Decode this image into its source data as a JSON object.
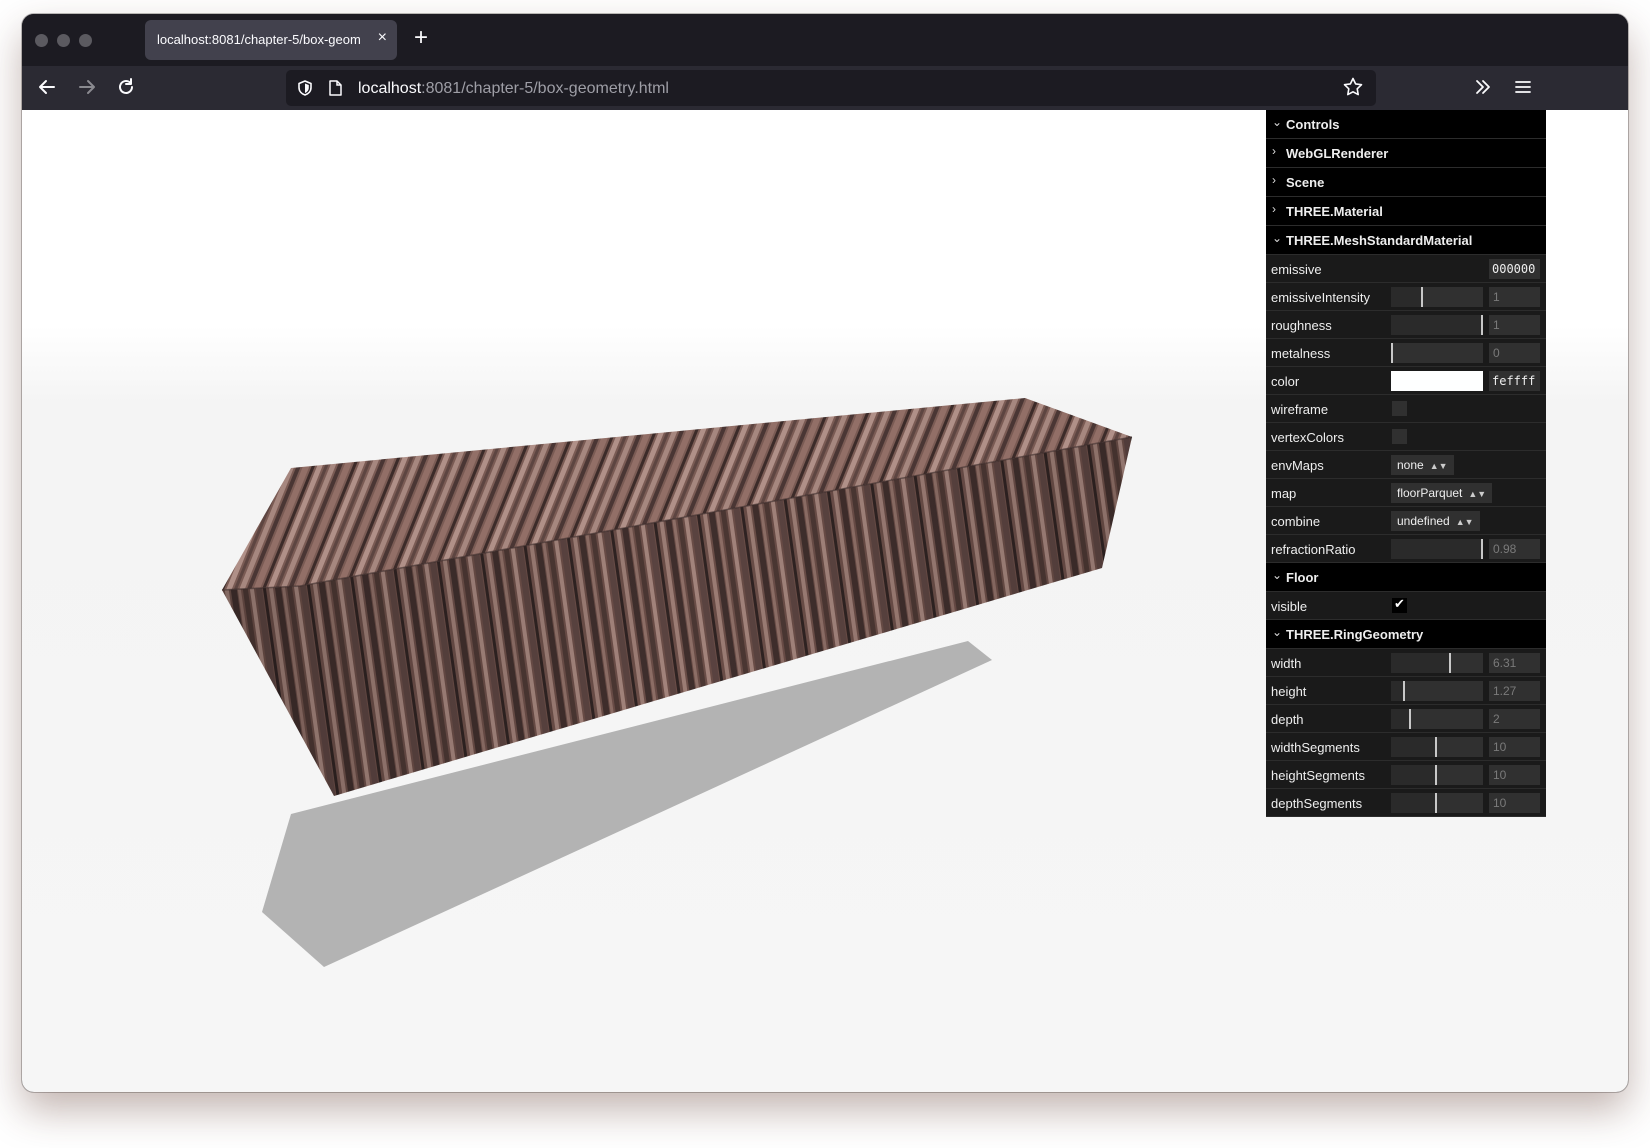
{
  "browser": {
    "tab_title": "localhost:8081/chapter-5/box-geom",
    "tab_close": "×",
    "new_tab": "+",
    "url_host": "localhost",
    "url_rest": ":8081/chapter-5/box-geometry.html",
    "icons": {
      "back": "back-arrow-icon",
      "forward": "forward-arrow-icon",
      "reload": "reload-icon",
      "shield": "shield-icon",
      "page": "page-icon",
      "bookmark": "star-icon",
      "overflow": "chevrons-right-icon",
      "menu": "hamburger-menu-icon"
    }
  },
  "gui": {
    "folders": {
      "controls": "Controls",
      "webgl": "WebGLRenderer",
      "scene": "Scene",
      "material": "THREE.Material",
      "standard": "THREE.MeshStandardMaterial",
      "floor": "Floor",
      "ring": "THREE.RingGeometry"
    },
    "material": {
      "emissive": {
        "label": "emissive",
        "value": "000000"
      },
      "emissiveIntensity": {
        "label": "emissiveIntensity",
        "value": "1",
        "level": 0.33
      },
      "roughness": {
        "label": "roughness",
        "value": "1",
        "level": 0.98
      },
      "metalness": {
        "label": "metalness",
        "value": "0",
        "level": 0.0
      },
      "color": {
        "label": "color",
        "value": "feffff",
        "swatch": "#feffff"
      },
      "wireframe": {
        "label": "wireframe",
        "checked": false
      },
      "vertexColors": {
        "label": "vertexColors",
        "checked": false
      },
      "envMaps": {
        "label": "envMaps",
        "value": "none"
      },
      "map": {
        "label": "map",
        "value": "floorParquet"
      },
      "combine": {
        "label": "combine",
        "value": "undefined"
      },
      "refractionRatio": {
        "label": "refractionRatio",
        "value": "0.98",
        "level": 0.98
      }
    },
    "floor": {
      "visible": {
        "label": "visible",
        "checked": true
      }
    },
    "geometry": {
      "width": {
        "label": "width",
        "value": "6.31",
        "level": 0.63
      },
      "height": {
        "label": "height",
        "value": "1.27",
        "level": 0.13
      },
      "depth": {
        "label": "depth",
        "value": "2",
        "level": 0.2
      },
      "widthSegments": {
        "label": "widthSegments",
        "value": "10",
        "level": 0.48
      },
      "heightSegments": {
        "label": "heightSegments",
        "value": "10",
        "level": 0.48
      },
      "depthSegments": {
        "label": "depthSegments",
        "value": "10",
        "level": 0.48
      }
    }
  },
  "colors": {
    "wood_light": "#8a6a62",
    "wood_dark": "#3e2e2c",
    "shadow": "#b3b3b3",
    "gui_bg": "#1a1a1a",
    "traffic": "#5b5a60"
  }
}
